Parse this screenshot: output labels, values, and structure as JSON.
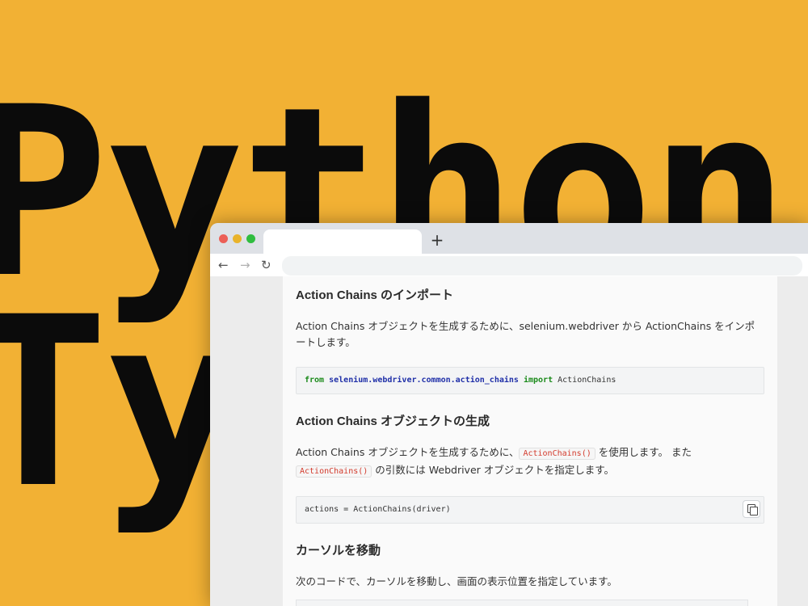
{
  "background": {
    "color": "#f2b134",
    "line1": "Python",
    "line2": "Typing"
  },
  "browser": {
    "tab_title": "",
    "new_tab_icon": "+",
    "back_icon": "←",
    "forward_icon": "→",
    "reload_icon": "↻",
    "address": ""
  },
  "article": {
    "section1": {
      "heading": "Action Chains のインポート",
      "paragraph": "Action Chains オブジェクトを生成するために、selenium.webdriver から ActionChains をインポートします。",
      "code": {
        "kw_from": "from",
        "module": "selenium.webdriver.common.action_chains",
        "kw_import": "import",
        "name": "ActionChains"
      }
    },
    "section2": {
      "heading": "Action Chains オブジェクトの生成",
      "para_a": "Action Chains オブジェクトを生成するために、",
      "inline_code_1": "ActionChains()",
      "para_b": "を使用します。 また",
      "inline_code_2": "ActionChains()",
      "para_c": "の引数には Webdriver オブジェクトを指定します。",
      "code": "actions = ActionChains(driver)"
    },
    "section3": {
      "heading": "カーソルを移動",
      "paragraph": "次のコードで、カーソルを移動し、画面の表示位置を指定しています。"
    }
  }
}
